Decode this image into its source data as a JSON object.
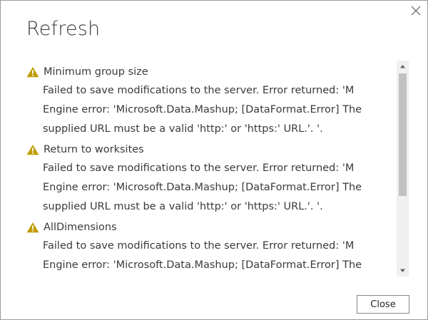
{
  "dialog": {
    "title": "Refresh",
    "close_icon": "close-icon"
  },
  "entries": [
    {
      "icon": "warning-icon",
      "name": "Minimum group size",
      "message": "Failed to save modifications to the server. Error returned: 'M Engine error: 'Microsoft.Data.Mashup; [DataFormat.Error] The supplied URL must be a valid 'http:' or 'https:' URL.'. '."
    },
    {
      "icon": "warning-icon",
      "name": "Return to worksites",
      "message": "Failed to save modifications to the server. Error returned: 'M Engine error: 'Microsoft.Data.Mashup; [DataFormat.Error] The supplied URL must be a valid 'http:' or 'https:' URL.'. '."
    },
    {
      "icon": "warning-icon",
      "name": "AllDimensions",
      "message": "Failed to save modifications to the server. Error returned: 'M Engine error: 'Microsoft.Data.Mashup; [DataFormat.Error] The supplied URL must be a valid 'http:' or 'https:' URL.'. '."
    }
  ],
  "footer": {
    "close_label": "Close"
  },
  "colors": {
    "warning": "#c19c00",
    "text": "#3b3a39",
    "scroll_track": "#f0f0f0",
    "scroll_thumb": "#c1c1c1"
  }
}
